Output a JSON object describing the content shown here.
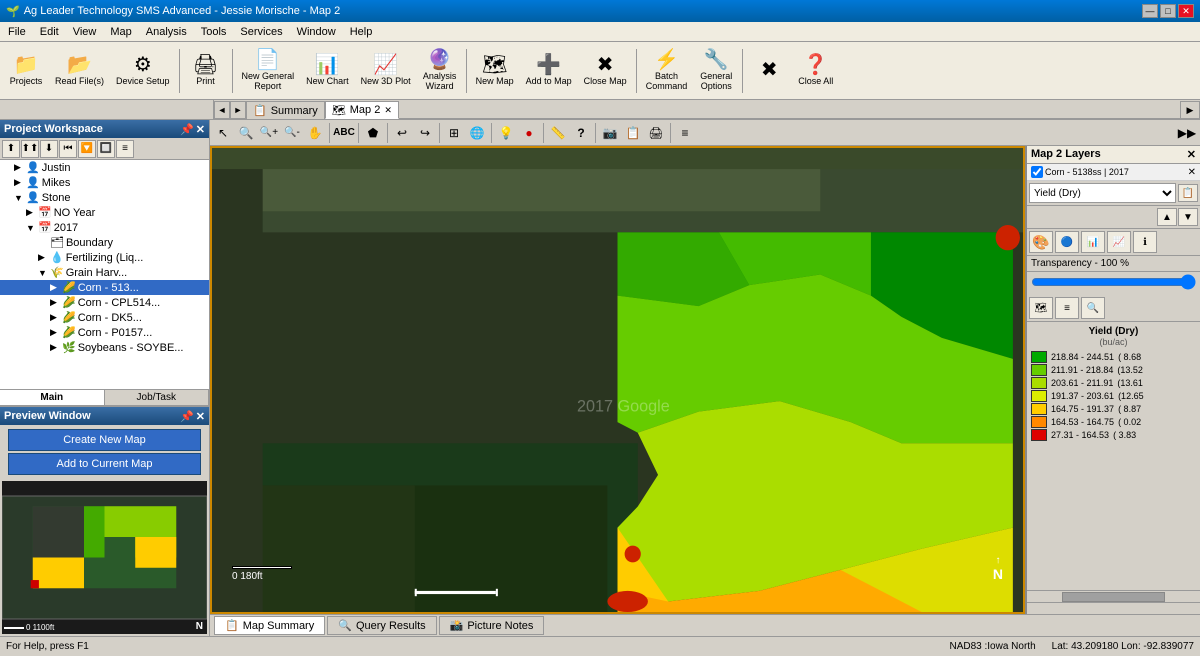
{
  "titlebar": {
    "title": "Ag Leader Technology SMS Advanced - Jessie Morische - Map 2",
    "icon": "🌱",
    "controls": [
      "—",
      "□",
      "✕"
    ]
  },
  "menubar": {
    "items": [
      "File",
      "Edit",
      "View",
      "Map",
      "Analysis",
      "Tools",
      "Services",
      "Window",
      "Help"
    ]
  },
  "toolbar": {
    "buttons": [
      {
        "id": "projects",
        "icon": "📁",
        "label": "Projects"
      },
      {
        "id": "read-files",
        "icon": "📂",
        "label": "Read File(s)"
      },
      {
        "id": "device-setup",
        "icon": "⚙",
        "label": "Device Setup"
      },
      {
        "id": "sep1",
        "type": "sep"
      },
      {
        "id": "print",
        "icon": "🖨",
        "label": "Print"
      },
      {
        "id": "sep2",
        "type": "sep"
      },
      {
        "id": "new-general-report",
        "icon": "📄",
        "label": "New General\nReport"
      },
      {
        "id": "new-chart",
        "icon": "📊",
        "label": "New Chart"
      },
      {
        "id": "new-3d-plot",
        "icon": "📈",
        "label": "New 3D Plot"
      },
      {
        "id": "analysis-wizard",
        "icon": "🔮",
        "label": "Analysis\nWizard"
      },
      {
        "id": "sep3",
        "type": "sep"
      },
      {
        "id": "new-map",
        "icon": "🗺",
        "label": "New Map"
      },
      {
        "id": "add-to-map",
        "icon": "➕",
        "label": "Add to Map"
      },
      {
        "id": "close-map",
        "icon": "✖",
        "label": "Close Map"
      },
      {
        "id": "sep4",
        "type": "sep"
      },
      {
        "id": "batch-command",
        "icon": "⚡",
        "label": "Batch\nCommand"
      },
      {
        "id": "general-options",
        "icon": "🔧",
        "label": "General\nOptions"
      },
      {
        "id": "sep5",
        "type": "sep"
      },
      {
        "id": "close-all",
        "icon": "✖✖",
        "label": "Close All"
      },
      {
        "id": "help-topics",
        "icon": "❓",
        "label": "Help Topics"
      }
    ]
  },
  "tabs": {
    "nav_prev": "◄",
    "nav_next": "►",
    "items": [
      {
        "id": "summary",
        "label": "Summary",
        "icon": "📋",
        "active": false,
        "closable": false
      },
      {
        "id": "map2",
        "label": "Map 2",
        "icon": "🗺",
        "active": true,
        "closable": true
      }
    ]
  },
  "project_workspace": {
    "title": "Project Workspace",
    "pin_icon": "📌",
    "close_icon": "✕",
    "toolbar_icons": [
      "⬆",
      "⬆⬆",
      "⬇",
      "⏮",
      "🔽",
      "🔲",
      "≡"
    ],
    "tree": [
      {
        "id": "justin",
        "label": "Justin",
        "level": 0,
        "icon": "👤",
        "expanded": false
      },
      {
        "id": "mikes",
        "label": "Mikes",
        "level": 0,
        "icon": "👤",
        "expanded": false
      },
      {
        "id": "stone",
        "label": "Stone",
        "level": 0,
        "icon": "👤",
        "expanded": true
      },
      {
        "id": "no-year",
        "label": "NO Year",
        "level": 1,
        "icon": "📅",
        "expanded": false
      },
      {
        "id": "2017",
        "label": "2017",
        "level": 1,
        "icon": "📅",
        "expanded": true
      },
      {
        "id": "boundary",
        "label": "Boundary",
        "level": 2,
        "icon": "🗂",
        "expanded": false
      },
      {
        "id": "fertilizing",
        "label": "Fertilizing (Liq...",
        "level": 2,
        "icon": "💧",
        "expanded": false
      },
      {
        "id": "grain-harv",
        "label": "Grain Harv...",
        "level": 2,
        "icon": "🌾",
        "expanded": true
      },
      {
        "id": "corn-513",
        "label": "Corn - 513...",
        "level": 3,
        "icon": "🌽",
        "expanded": false,
        "selected": true
      },
      {
        "id": "corn-cpl514",
        "label": "Corn - CPL514...",
        "level": 3,
        "icon": "🌽",
        "expanded": false
      },
      {
        "id": "corn-dk5",
        "label": "Corn - DK5...",
        "level": 3,
        "icon": "🌽",
        "expanded": false
      },
      {
        "id": "corn-p0157",
        "label": "Corn - P0157...",
        "level": 3,
        "icon": "🌽",
        "expanded": false
      },
      {
        "id": "soybeans-soybe",
        "label": "Soybeans - SOYBE...",
        "level": 3,
        "icon": "🌿",
        "expanded": false
      }
    ],
    "tabs": [
      {
        "id": "main",
        "label": "Main",
        "active": true
      },
      {
        "id": "job-task",
        "label": "Job/Task",
        "active": false
      }
    ]
  },
  "preview_window": {
    "title": "Preview Window",
    "pin_icon": "📌",
    "close_icon": "✕",
    "create_new_map_btn": "Create New Map",
    "add_current_map_btn": "Add to Current Map",
    "scale_label": "0        1100ft",
    "north_label": "N"
  },
  "map_toolbar": {
    "tools": [
      "↖",
      "🔍",
      "🔍+",
      "🔍-",
      "✋",
      "ABC",
      "⬟",
      "↩",
      "↪",
      "⊞",
      "🌐",
      "💡",
      "●",
      "📏",
      "?",
      "📷",
      "📋",
      "🖨",
      "≡",
      "◀",
      "▶"
    ]
  },
  "map_area": {
    "watermark": "2017 Google",
    "scale_label": "0       180ft",
    "north_label": "N"
  },
  "right_panel": {
    "title": "Map 2 Layers",
    "layer": {
      "name": "Corn - 5138ss | 2017",
      "checked": true,
      "close_icon": "✕"
    },
    "dropdown_value": "Yield (Dry)",
    "transparency_label": "Transparency - 100 %",
    "legend": {
      "title": "Yield (Dry)",
      "unit": "(bu/ac)",
      "items": [
        {
          "color": "#00aa00",
          "range": "218.84 - 244.51",
          "count": "( 8.68"
        },
        {
          "color": "#66cc00",
          "range": "211.91 - 218.84",
          "count": "(13.52"
        },
        {
          "color": "#aadd00",
          "range": "203.61 - 211.91",
          "count": "(13.61"
        },
        {
          "color": "#ddee00",
          "range": "191.37 - 203.61",
          "count": "(12.65"
        },
        {
          "color": "#ffcc00",
          "range": "164.75 - 191.37",
          "count": "( 8.87"
        },
        {
          "color": "#ff8800",
          "range": "164.53 - 164.75",
          "count": "( 0.02"
        },
        {
          "color": "#dd0000",
          "range": "27.31  - 164.53",
          "count": "( 3.83"
        }
      ]
    }
  },
  "map_bottom_tabs": [
    {
      "id": "map-summary",
      "label": "Map Summary",
      "icon": "📋",
      "active": true
    },
    {
      "id": "query-results",
      "label": "Query Results",
      "icon": "🔍",
      "active": false
    },
    {
      "id": "picture-notes",
      "label": "Picture Notes",
      "icon": "📸",
      "active": false
    }
  ],
  "status_bar": {
    "help_text": "For Help, press F1",
    "projection": "NAD83 :Iowa North",
    "coords": "Lat: 43.209180  Lon: -92.839077"
  },
  "layer_panel_title": "Map 2 Layers"
}
